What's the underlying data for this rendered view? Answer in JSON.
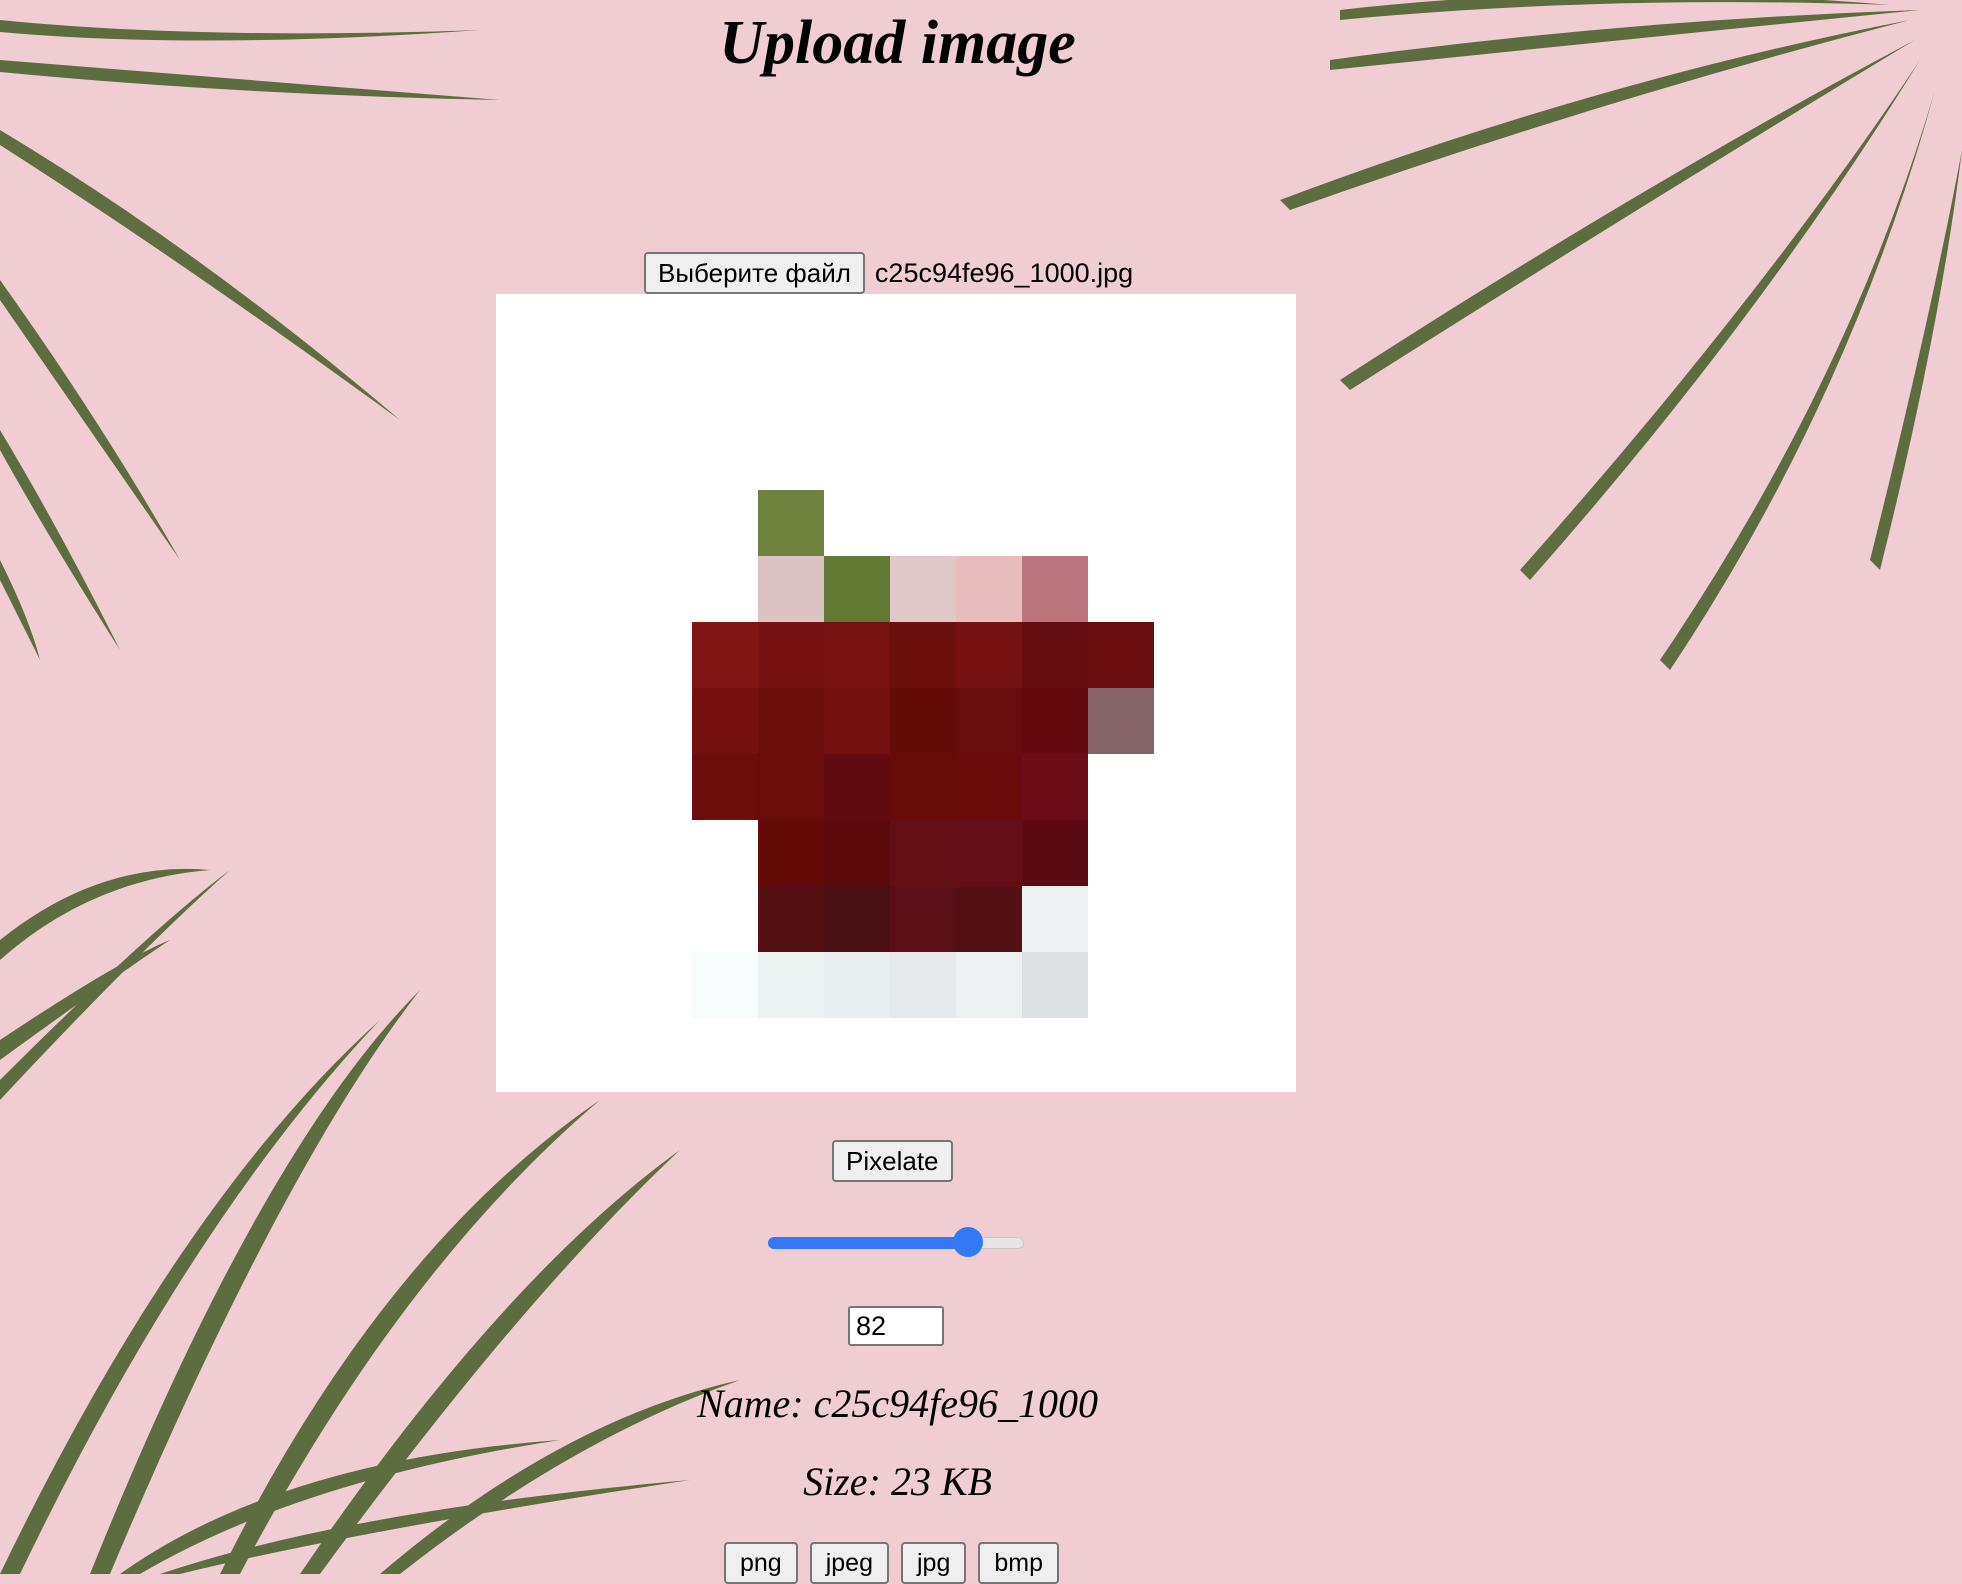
{
  "page": {
    "title": "Upload image"
  },
  "file_input": {
    "button_label": "Выберите файл",
    "file_name": "c25c94fe96_1000.jpg"
  },
  "pixel_image": {
    "grid_columns": 12,
    "grid_rows": 12,
    "cells": [
      {
        "col": 4,
        "row": 3,
        "color": "#6f823d"
      },
      {
        "col": 4,
        "row": 4,
        "color": "#dcc3c3"
      },
      {
        "col": 5,
        "row": 4,
        "color": "#637a35"
      },
      {
        "col": 6,
        "row": 4,
        "color": "#e0c8c8"
      },
      {
        "col": 7,
        "row": 4,
        "color": "#e6bcbc"
      },
      {
        "col": 8,
        "row": 4,
        "color": "#b9757b"
      },
      {
        "col": 3,
        "row": 5,
        "color": "#811514"
      },
      {
        "col": 4,
        "row": 5,
        "color": "#771212"
      },
      {
        "col": 5,
        "row": 5,
        "color": "#791313"
      },
      {
        "col": 6,
        "row": 5,
        "color": "#6c100e"
      },
      {
        "col": 7,
        "row": 5,
        "color": "#761211"
      },
      {
        "col": 8,
        "row": 5,
        "color": "#650d0e"
      },
      {
        "col": 9,
        "row": 5,
        "color": "#6a0c0d"
      },
      {
        "col": 3,
        "row": 6,
        "color": "#741110"
      },
      {
        "col": 4,
        "row": 6,
        "color": "#6b0d0c"
      },
      {
        "col": 5,
        "row": 6,
        "color": "#731111"
      },
      {
        "col": 6,
        "row": 6,
        "color": "#640c0a"
      },
      {
        "col": 7,
        "row": 6,
        "color": "#690e0e"
      },
      {
        "col": 8,
        "row": 6,
        "color": "#660b0d"
      },
      {
        "col": 9,
        "row": 6,
        "color": "#856468"
      },
      {
        "col": 3,
        "row": 7,
        "color": "#6c0d0d"
      },
      {
        "col": 4,
        "row": 7,
        "color": "#690c0c"
      },
      {
        "col": 5,
        "row": 7,
        "color": "#600c10"
      },
      {
        "col": 6,
        "row": 7,
        "color": "#660c0a"
      },
      {
        "col": 7,
        "row": 7,
        "color": "#670c0b"
      },
      {
        "col": 8,
        "row": 7,
        "color": "#6b0e17"
      },
      {
        "col": 4,
        "row": 8,
        "color": "#650c0b"
      },
      {
        "col": 5,
        "row": 8,
        "color": "#5c0a0c"
      },
      {
        "col": 6,
        "row": 8,
        "color": "#620f16"
      },
      {
        "col": 7,
        "row": 8,
        "color": "#640f18"
      },
      {
        "col": 8,
        "row": 8,
        "color": "#5c0b12"
      },
      {
        "col": 4,
        "row": 9,
        "color": "#551114"
      },
      {
        "col": 5,
        "row": 9,
        "color": "#4a0f13"
      },
      {
        "col": 6,
        "row": 9,
        "color": "#5b1017"
      },
      {
        "col": 7,
        "row": 9,
        "color": "#531115"
      },
      {
        "col": 8,
        "row": 9,
        "color": "#eef0f3"
      },
      {
        "col": 3,
        "row": 10,
        "color": "#f8fbfb"
      },
      {
        "col": 4,
        "row": 10,
        "color": "#ecf1f2"
      },
      {
        "col": 5,
        "row": 10,
        "color": "#e9eef0"
      },
      {
        "col": 6,
        "row": 10,
        "color": "#e5e9eb"
      },
      {
        "col": 7,
        "row": 10,
        "color": "#ecf0f1"
      },
      {
        "col": 8,
        "row": 10,
        "color": "#dcdfe0"
      }
    ]
  },
  "controls": {
    "pixelate_label": "Pixelate",
    "slider_value_fraction": 0.78,
    "pixel_size_value": "82",
    "accent_color": "#3478f6"
  },
  "info": {
    "name": "Name: c25c94fe96_1000",
    "size": "Size: 23 KB"
  },
  "formats": [
    "png",
    "jpeg",
    "jpg",
    "bmp"
  ]
}
